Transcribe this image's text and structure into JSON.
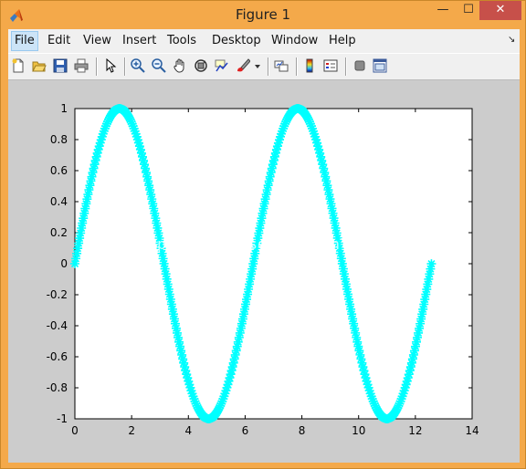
{
  "window": {
    "title": "Figure 1",
    "min_glyph": "—",
    "max_glyph": "☐",
    "close_glyph": "✕"
  },
  "menu": {
    "items": [
      {
        "label": "File"
      },
      {
        "label": "Edit"
      },
      {
        "label": "View"
      },
      {
        "label": "Insert"
      },
      {
        "label": "Tools"
      },
      {
        "label": "Desktop"
      },
      {
        "label": "Window"
      },
      {
        "label": "Help"
      }
    ],
    "dock_glyph": "↘"
  },
  "toolbar": {
    "icons": [
      "new-figure-icon",
      "open-file-icon",
      "save-icon",
      "print-icon",
      "pointer-icon",
      "zoom-in-icon",
      "zoom-out-icon",
      "pan-hand-icon",
      "rotate-3d-icon",
      "data-cursor-icon",
      "brush-icon",
      "brush-dropdown-icon",
      "link-plot-icon",
      "colorbar-icon",
      "legend-icon",
      "hide-plot-tools-icon",
      "show-plot-tools-icon"
    ]
  },
  "watermark": "http://blog.csdn.net/gnls200808",
  "colors": {
    "series": "#00ffff",
    "axes_bg": "#ffffff",
    "figure_bg": "#cccccc"
  },
  "chart_data": {
    "type": "line",
    "marker": "*",
    "function": "y = sin(x)",
    "x_range": [
      0,
      12.566
    ],
    "title": "",
    "xlabel": "",
    "ylabel": "",
    "xlim": [
      0,
      14
    ],
    "ylim": [
      -1,
      1
    ],
    "xticks": [
      "0",
      "2",
      "4",
      "6",
      "8",
      "10",
      "12",
      "14"
    ],
    "yticks": [
      "-1",
      "-0.8",
      "-0.6",
      "-0.4",
      "-0.2",
      "0",
      "0.2",
      "0.4",
      "0.6",
      "0.8",
      "1"
    ],
    "grid": false,
    "series": [
      {
        "color": "#00ffff",
        "x": [
          0,
          0.5,
          1,
          1.5708,
          2,
          2.5,
          3,
          3.1416,
          3.5,
          4,
          4.5,
          4.7124,
          5,
          5.5,
          6,
          6.2832,
          6.5,
          7,
          7.5,
          7.854,
          8,
          8.5,
          9,
          9.4248,
          10,
          10.5,
          10.9956,
          11.5,
          12,
          12.566
        ],
        "y": [
          0,
          0.479,
          0.841,
          1,
          0.909,
          0.598,
          0.141,
          0,
          -0.351,
          -0.757,
          -0.978,
          -1,
          -0.959,
          -0.706,
          -0.279,
          0,
          0.215,
          0.657,
          0.938,
          1,
          0.989,
          0.798,
          0.412,
          0,
          -0.544,
          -0.88,
          -1,
          -0.875,
          -0.537,
          0
        ]
      }
    ]
  }
}
